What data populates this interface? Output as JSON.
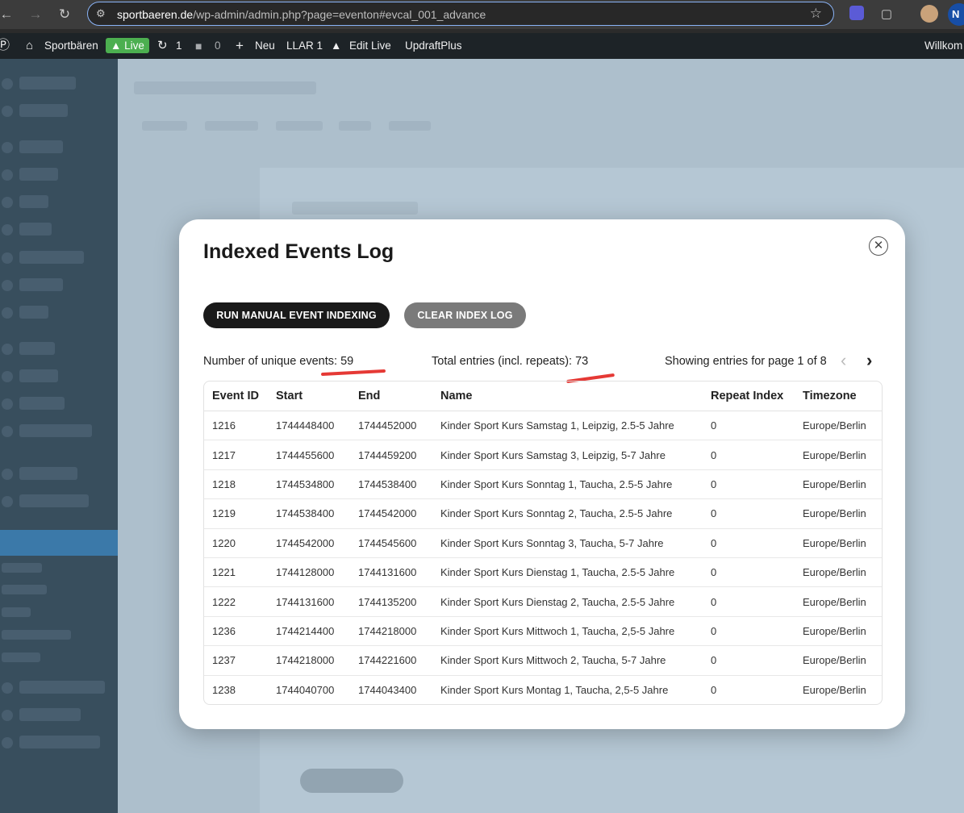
{
  "browser": {
    "url_host": "sportbaeren.de",
    "url_path": "/wp-admin/admin.php?page=eventon#evcal_001_advance",
    "profile_initial": "N"
  },
  "adminbar": {
    "site_name": "Sportbären",
    "live_badge": "Live",
    "updates_count": "1",
    "comments_count": "0",
    "new_label": "Neu",
    "llar_label": "LLAR",
    "llar_count": "1",
    "edit_live_label": "Edit Live",
    "updraft_label": "UpdraftPlus",
    "welcome_label": "Willkom"
  },
  "modal": {
    "title": "Indexed Events Log",
    "run_button": "RUN MANUAL EVENT INDEXING",
    "clear_button": "CLEAR INDEX LOG",
    "unique_events": "Number of unique events: 59",
    "total_entries": "Total entries (incl. repeats): 73",
    "page_info": "Showing entries for page 1 of 8",
    "columns": [
      "Event ID",
      "Start",
      "End",
      "Name",
      "Repeat Index",
      "Timezone"
    ],
    "rows": [
      [
        "1216",
        "1744448400",
        "1744452000",
        "Kinder Sport Kurs Samstag 1, Leipzig, 2.5-5 Jahre",
        "0",
        "Europe/Berlin"
      ],
      [
        "1217",
        "1744455600",
        "1744459200",
        "Kinder Sport Kurs Samstag 3, Leipzig, 5-7 Jahre",
        "0",
        "Europe/Berlin"
      ],
      [
        "1218",
        "1744534800",
        "1744538400",
        "Kinder Sport Kurs Sonntag 1, Taucha, 2.5-5 Jahre",
        "0",
        "Europe/Berlin"
      ],
      [
        "1219",
        "1744538400",
        "1744542000",
        "Kinder Sport Kurs Sonntag 2, Taucha, 2.5-5 Jahre",
        "0",
        "Europe/Berlin"
      ],
      [
        "1220",
        "1744542000",
        "1744545600",
        "Kinder Sport Kurs Sonntag 3, Taucha, 5-7 Jahre",
        "0",
        "Europe/Berlin"
      ],
      [
        "1221",
        "1744128000",
        "1744131600",
        "Kinder Sport Kurs Dienstag 1, Taucha, 2.5-5 Jahre",
        "0",
        "Europe/Berlin"
      ],
      [
        "1222",
        "1744131600",
        "1744135200",
        "Kinder Sport Kurs Dienstag 2, Taucha, 2.5-5 Jahre",
        "0",
        "Europe/Berlin"
      ],
      [
        "1236",
        "1744214400",
        "1744218000",
        "Kinder Sport Kurs Mittwoch 1, Taucha, 2,5-5 Jahre",
        "0",
        "Europe/Berlin"
      ],
      [
        "1237",
        "1744218000",
        "1744221600",
        "Kinder Sport Kurs Mittwoch 2, Taucha, 5-7 Jahre",
        "0",
        "Europe/Berlin"
      ],
      [
        "1238",
        "1744040700",
        "1744043400",
        "Kinder Sport Kurs Montag 1, Taucha, 2,5-5 Jahre",
        "0",
        "Europe/Berlin"
      ]
    ]
  },
  "colors": {
    "annotation": "#e53935",
    "primary_button": "#1a1a1a",
    "secondary_button": "#7a7a7a"
  }
}
